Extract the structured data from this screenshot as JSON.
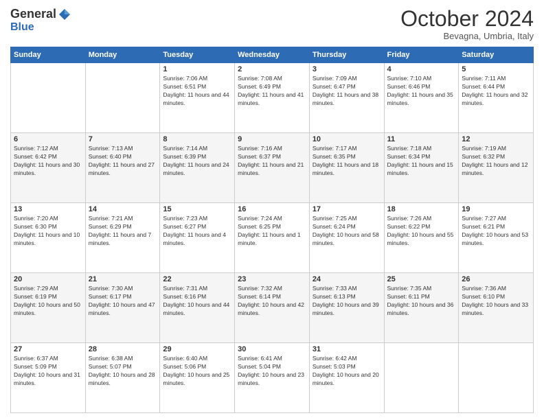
{
  "logo": {
    "general": "General",
    "blue": "Blue"
  },
  "header": {
    "month": "October 2024",
    "location": "Bevagna, Umbria, Italy"
  },
  "weekdays": [
    "Sunday",
    "Monday",
    "Tuesday",
    "Wednesday",
    "Thursday",
    "Friday",
    "Saturday"
  ],
  "weeks": [
    [
      {
        "day": null
      },
      {
        "day": null
      },
      {
        "day": 1,
        "sunrise": "Sunrise: 7:06 AM",
        "sunset": "Sunset: 6:51 PM",
        "daylight": "Daylight: 11 hours and 44 minutes."
      },
      {
        "day": 2,
        "sunrise": "Sunrise: 7:08 AM",
        "sunset": "Sunset: 6:49 PM",
        "daylight": "Daylight: 11 hours and 41 minutes."
      },
      {
        "day": 3,
        "sunrise": "Sunrise: 7:09 AM",
        "sunset": "Sunset: 6:47 PM",
        "daylight": "Daylight: 11 hours and 38 minutes."
      },
      {
        "day": 4,
        "sunrise": "Sunrise: 7:10 AM",
        "sunset": "Sunset: 6:46 PM",
        "daylight": "Daylight: 11 hours and 35 minutes."
      },
      {
        "day": 5,
        "sunrise": "Sunrise: 7:11 AM",
        "sunset": "Sunset: 6:44 PM",
        "daylight": "Daylight: 11 hours and 32 minutes."
      }
    ],
    [
      {
        "day": 6,
        "sunrise": "Sunrise: 7:12 AM",
        "sunset": "Sunset: 6:42 PM",
        "daylight": "Daylight: 11 hours and 30 minutes."
      },
      {
        "day": 7,
        "sunrise": "Sunrise: 7:13 AM",
        "sunset": "Sunset: 6:40 PM",
        "daylight": "Daylight: 11 hours and 27 minutes."
      },
      {
        "day": 8,
        "sunrise": "Sunrise: 7:14 AM",
        "sunset": "Sunset: 6:39 PM",
        "daylight": "Daylight: 11 hours and 24 minutes."
      },
      {
        "day": 9,
        "sunrise": "Sunrise: 7:16 AM",
        "sunset": "Sunset: 6:37 PM",
        "daylight": "Daylight: 11 hours and 21 minutes."
      },
      {
        "day": 10,
        "sunrise": "Sunrise: 7:17 AM",
        "sunset": "Sunset: 6:35 PM",
        "daylight": "Daylight: 11 hours and 18 minutes."
      },
      {
        "day": 11,
        "sunrise": "Sunrise: 7:18 AM",
        "sunset": "Sunset: 6:34 PM",
        "daylight": "Daylight: 11 hours and 15 minutes."
      },
      {
        "day": 12,
        "sunrise": "Sunrise: 7:19 AM",
        "sunset": "Sunset: 6:32 PM",
        "daylight": "Daylight: 11 hours and 12 minutes."
      }
    ],
    [
      {
        "day": 13,
        "sunrise": "Sunrise: 7:20 AM",
        "sunset": "Sunset: 6:30 PM",
        "daylight": "Daylight: 11 hours and 10 minutes."
      },
      {
        "day": 14,
        "sunrise": "Sunrise: 7:21 AM",
        "sunset": "Sunset: 6:29 PM",
        "daylight": "Daylight: 11 hours and 7 minutes."
      },
      {
        "day": 15,
        "sunrise": "Sunrise: 7:23 AM",
        "sunset": "Sunset: 6:27 PM",
        "daylight": "Daylight: 11 hours and 4 minutes."
      },
      {
        "day": 16,
        "sunrise": "Sunrise: 7:24 AM",
        "sunset": "Sunset: 6:25 PM",
        "daylight": "Daylight: 11 hours and 1 minute."
      },
      {
        "day": 17,
        "sunrise": "Sunrise: 7:25 AM",
        "sunset": "Sunset: 6:24 PM",
        "daylight": "Daylight: 10 hours and 58 minutes."
      },
      {
        "day": 18,
        "sunrise": "Sunrise: 7:26 AM",
        "sunset": "Sunset: 6:22 PM",
        "daylight": "Daylight: 10 hours and 55 minutes."
      },
      {
        "day": 19,
        "sunrise": "Sunrise: 7:27 AM",
        "sunset": "Sunset: 6:21 PM",
        "daylight": "Daylight: 10 hours and 53 minutes."
      }
    ],
    [
      {
        "day": 20,
        "sunrise": "Sunrise: 7:29 AM",
        "sunset": "Sunset: 6:19 PM",
        "daylight": "Daylight: 10 hours and 50 minutes."
      },
      {
        "day": 21,
        "sunrise": "Sunrise: 7:30 AM",
        "sunset": "Sunset: 6:17 PM",
        "daylight": "Daylight: 10 hours and 47 minutes."
      },
      {
        "day": 22,
        "sunrise": "Sunrise: 7:31 AM",
        "sunset": "Sunset: 6:16 PM",
        "daylight": "Daylight: 10 hours and 44 minutes."
      },
      {
        "day": 23,
        "sunrise": "Sunrise: 7:32 AM",
        "sunset": "Sunset: 6:14 PM",
        "daylight": "Daylight: 10 hours and 42 minutes."
      },
      {
        "day": 24,
        "sunrise": "Sunrise: 7:33 AM",
        "sunset": "Sunset: 6:13 PM",
        "daylight": "Daylight: 10 hours and 39 minutes."
      },
      {
        "day": 25,
        "sunrise": "Sunrise: 7:35 AM",
        "sunset": "Sunset: 6:11 PM",
        "daylight": "Daylight: 10 hours and 36 minutes."
      },
      {
        "day": 26,
        "sunrise": "Sunrise: 7:36 AM",
        "sunset": "Sunset: 6:10 PM",
        "daylight": "Daylight: 10 hours and 33 minutes."
      }
    ],
    [
      {
        "day": 27,
        "sunrise": "Sunrise: 6:37 AM",
        "sunset": "Sunset: 5:09 PM",
        "daylight": "Daylight: 10 hours and 31 minutes."
      },
      {
        "day": 28,
        "sunrise": "Sunrise: 6:38 AM",
        "sunset": "Sunset: 5:07 PM",
        "daylight": "Daylight: 10 hours and 28 minutes."
      },
      {
        "day": 29,
        "sunrise": "Sunrise: 6:40 AM",
        "sunset": "Sunset: 5:06 PM",
        "daylight": "Daylight: 10 hours and 25 minutes."
      },
      {
        "day": 30,
        "sunrise": "Sunrise: 6:41 AM",
        "sunset": "Sunset: 5:04 PM",
        "daylight": "Daylight: 10 hours and 23 minutes."
      },
      {
        "day": 31,
        "sunrise": "Sunrise: 6:42 AM",
        "sunset": "Sunset: 5:03 PM",
        "daylight": "Daylight: 10 hours and 20 minutes."
      },
      {
        "day": null
      },
      {
        "day": null
      }
    ]
  ]
}
